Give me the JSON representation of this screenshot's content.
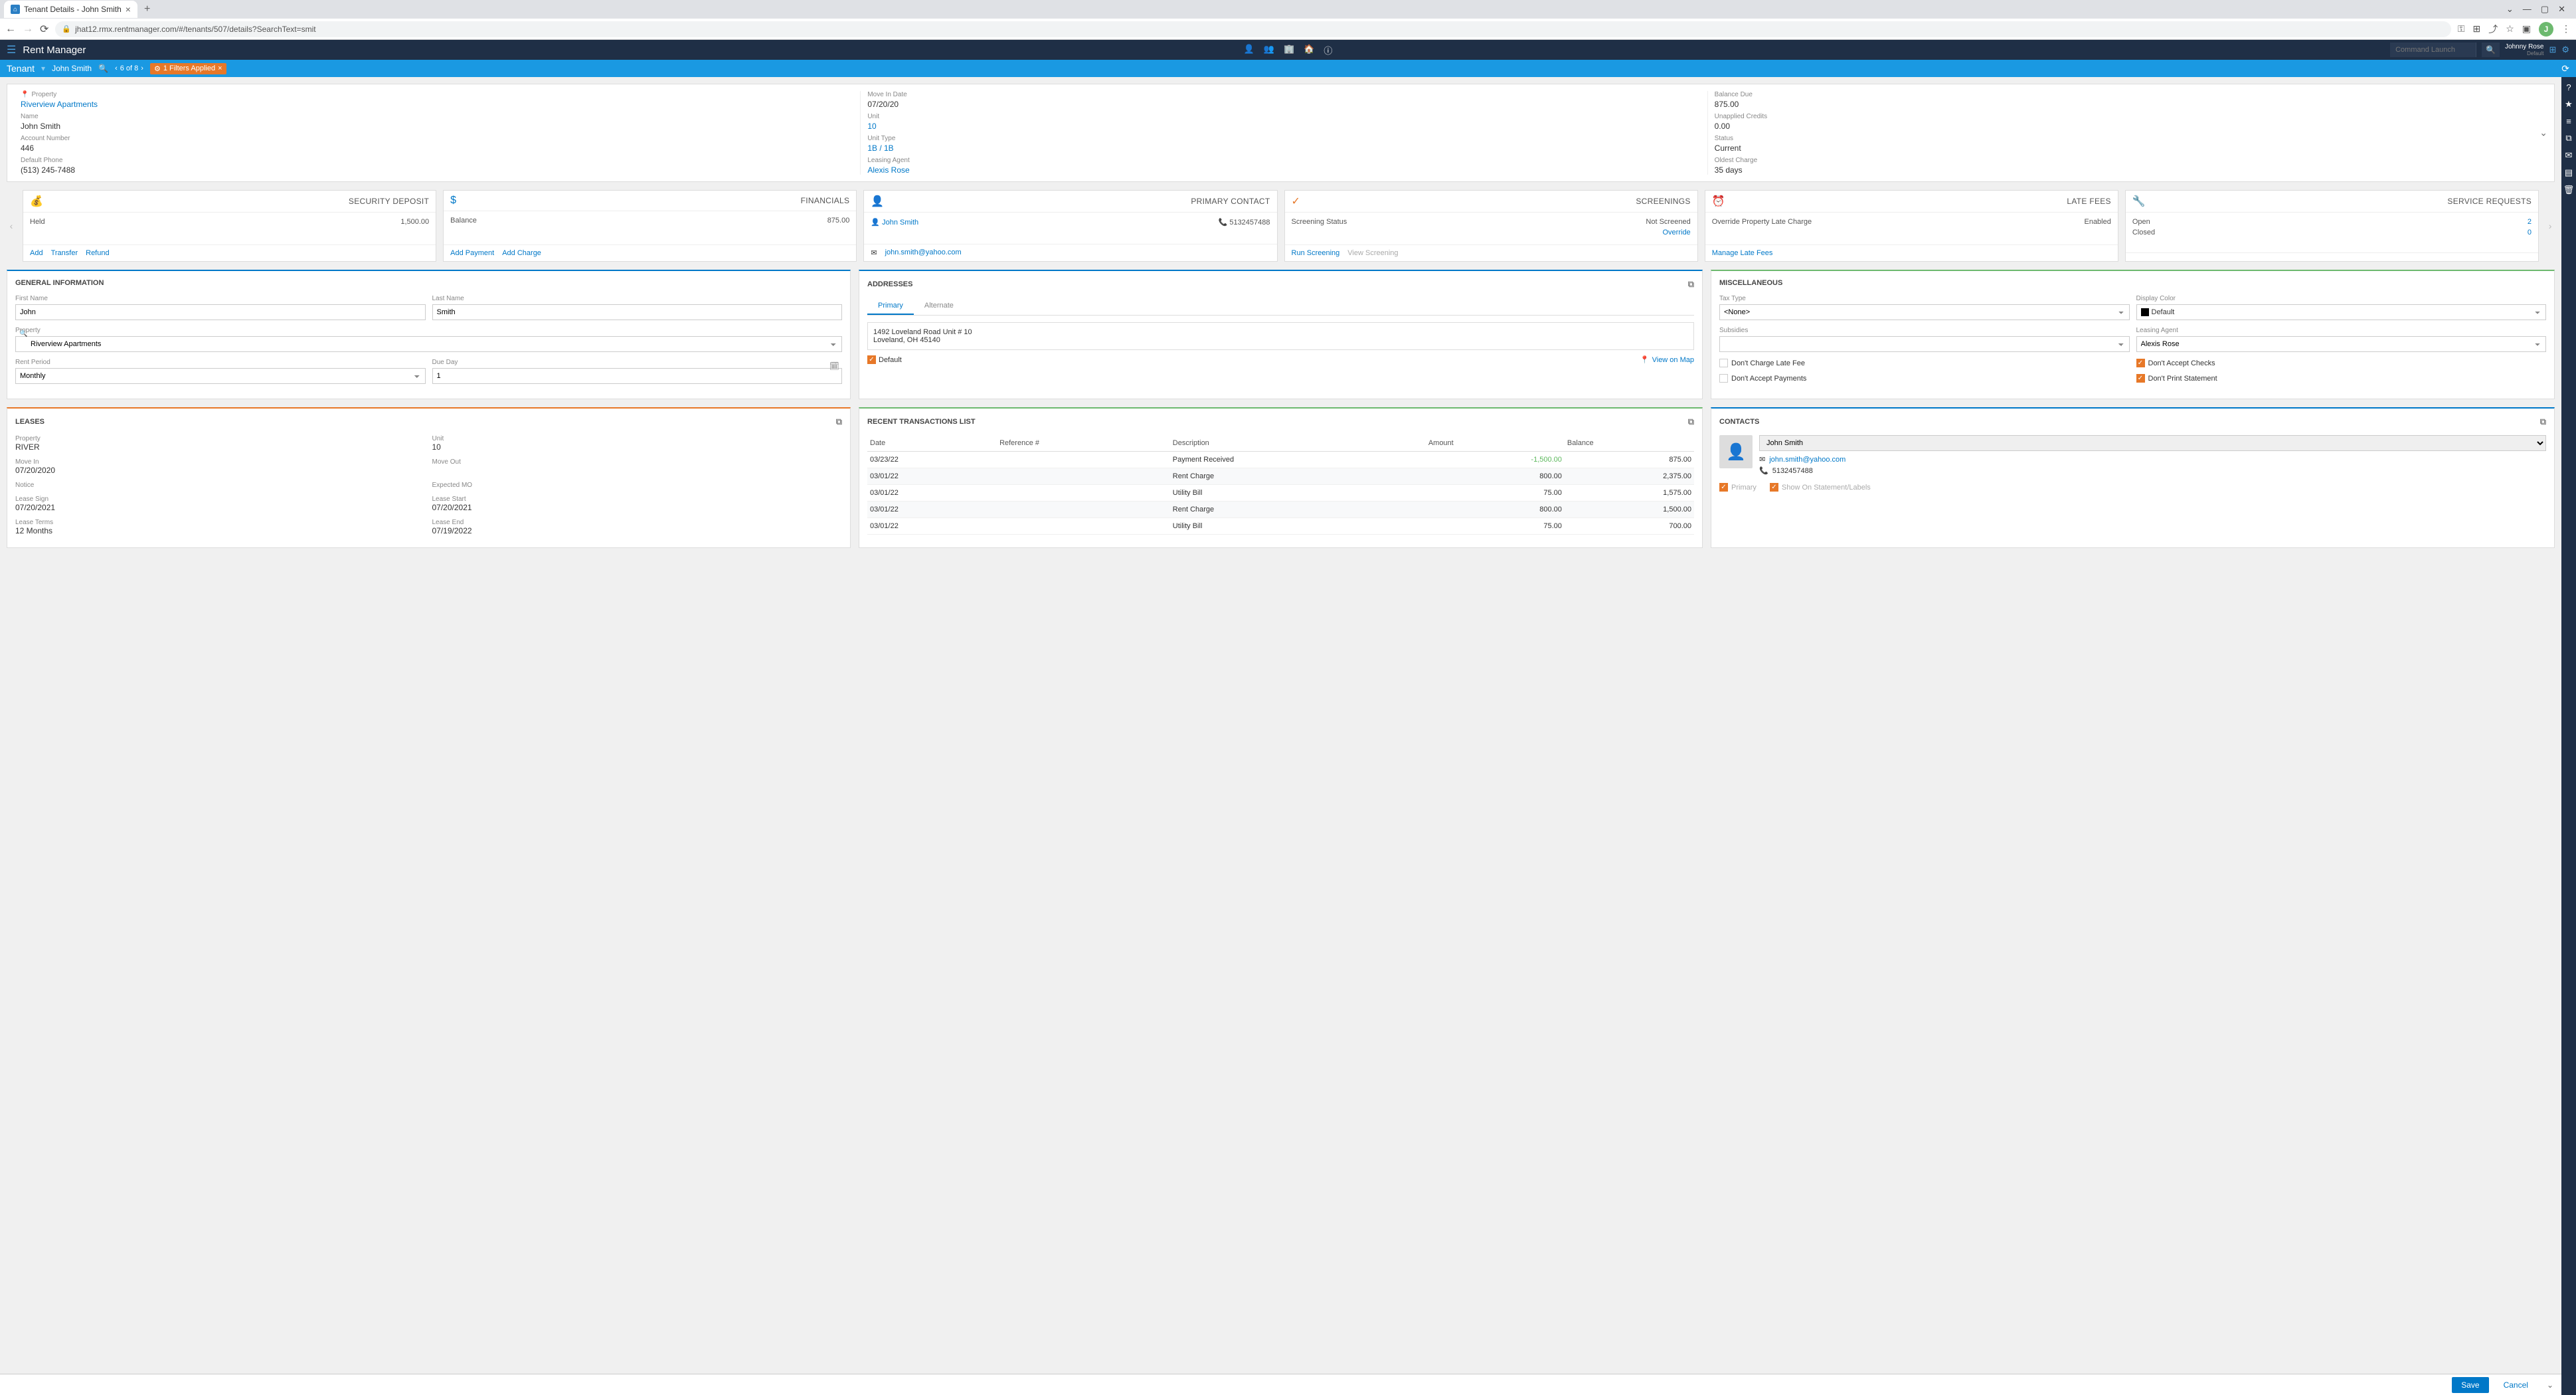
{
  "browser": {
    "tab_title": "Tenant Details - John Smith",
    "url": "jhat12.rmx.rentmanager.com/#/tenants/507/details?SearchText=smit",
    "profile_initial": "J"
  },
  "header": {
    "app_title": "Rent Manager",
    "command_placeholder": "Command Launch",
    "user_name": "Johnny Rose",
    "user_sub": "Default"
  },
  "secondary": {
    "page_type": "Tenant",
    "page_name": "John Smith",
    "pager": "6 of 8",
    "filter_text": "1 Filters Applied"
  },
  "summary": {
    "col1": {
      "property_label": "Property",
      "property_value": "Riverview Apartments",
      "name_label": "Name",
      "name_value": "John Smith",
      "acct_label": "Account Number",
      "acct_value": "446",
      "phone_label": "Default Phone",
      "phone_value": "(513) 245-7488"
    },
    "col2": {
      "movein_label": "Move In Date",
      "movein_value": "07/20/20",
      "unit_label": "Unit",
      "unit_value": "10",
      "unittype_label": "Unit Type",
      "unittype_value": "1B / 1B",
      "agent_label": "Leasing Agent",
      "agent_value": "Alexis Rose"
    },
    "col3": {
      "balance_label": "Balance Due",
      "balance_value": "875.00",
      "credits_label": "Unapplied Credits",
      "credits_value": "0.00",
      "status_label": "Status",
      "status_value": "Current",
      "oldest_label": "Oldest Charge",
      "oldest_value": "35 days"
    }
  },
  "tiles": {
    "security": {
      "title": "SECURITY DEPOSIT",
      "held_label": "Held",
      "held_value": "1,500.00",
      "add": "Add",
      "transfer": "Transfer",
      "refund": "Refund"
    },
    "financials": {
      "title": "FINANCIALS",
      "balance_label": "Balance",
      "balance_value": "875.00",
      "add_payment": "Add Payment",
      "add_charge": "Add Charge"
    },
    "primary_contact": {
      "title": "PRIMARY CONTACT",
      "name": "John Smith",
      "phone": "5132457488",
      "email": "john.smith@yahoo.com"
    },
    "screenings": {
      "title": "SCREENINGS",
      "status_label": "Screening Status",
      "status_value": "Not Screened",
      "override": "Override",
      "run": "Run Screening",
      "view": "View Screening"
    },
    "late_fees": {
      "title": "LATE FEES",
      "override_label": "Override Property Late Charge",
      "override_value": "Enabled",
      "manage": "Manage Late Fees"
    },
    "service": {
      "title": "SERVICE REQUESTS",
      "open_label": "Open",
      "open_value": "2",
      "closed_label": "Closed",
      "closed_value": "0"
    }
  },
  "general": {
    "title": "GENERAL INFORMATION",
    "first_name_label": "First Name",
    "first_name": "John",
    "last_name_label": "Last Name",
    "last_name": "Smith",
    "property_label": "Property",
    "property": "Riverview Apartments",
    "rent_period_label": "Rent Period",
    "rent_period": "Monthly",
    "due_day_label": "Due Day",
    "due_day": "1"
  },
  "addresses": {
    "title": "ADDRESSES",
    "tab_primary": "Primary",
    "tab_alternate": "Alternate",
    "line1": "1492 Loveland Road Unit # 10",
    "line2": "Loveland, OH 45140",
    "default_label": "Default",
    "view_map": "View on Map"
  },
  "misc": {
    "title": "MISCELLANEOUS",
    "tax_type_label": "Tax Type",
    "tax_type": "<None>",
    "display_color_label": "Display Color",
    "display_color": "Default",
    "subsidies_label": "Subsidies",
    "subsidies": "",
    "leasing_agent_label": "Leasing Agent",
    "leasing_agent": "Alexis Rose",
    "dont_charge_late": "Don't Charge Late Fee",
    "dont_accept_checks": "Don't Accept Checks",
    "dont_accept_payments": "Don't Accept Payments",
    "dont_print_statement": "Don't Print Statement"
  },
  "leases": {
    "title": "LEASES",
    "property_label": "Property",
    "property": "RIVER",
    "unit_label": "Unit",
    "unit": "10",
    "movein_label": "Move In",
    "movein": "07/20/2020",
    "moveout_label": "Move Out",
    "moveout": "",
    "notice_label": "Notice",
    "notice": "",
    "expected_mo_label": "Expected MO",
    "expected_mo": "",
    "lease_sign_label": "Lease Sign",
    "lease_sign": "07/20/2021",
    "lease_start_label": "Lease Start",
    "lease_start": "07/20/2021",
    "lease_terms_label": "Lease Terms",
    "lease_terms": "12 Months",
    "lease_end_label": "Lease End",
    "lease_end": "07/19/2022"
  },
  "transactions": {
    "title": "RECENT TRANSACTIONS LIST",
    "cols": {
      "date": "Date",
      "ref": "Reference #",
      "desc": "Description",
      "amount": "Amount",
      "balance": "Balance"
    },
    "rows": [
      {
        "date": "03/23/22",
        "ref": "",
        "desc": "Payment Received",
        "amount": "-1,500.00",
        "balance": "875.00",
        "neg": true
      },
      {
        "date": "03/01/22",
        "ref": "",
        "desc": "Rent Charge",
        "amount": "800.00",
        "balance": "2,375.00"
      },
      {
        "date": "03/01/22",
        "ref": "",
        "desc": "Utility Bill",
        "amount": "75.00",
        "balance": "1,575.00"
      },
      {
        "date": "03/01/22",
        "ref": "",
        "desc": "Rent Charge",
        "amount": "800.00",
        "balance": "1,500.00"
      },
      {
        "date": "03/01/22",
        "ref": "",
        "desc": "Utility Bill",
        "amount": "75.00",
        "balance": "700.00"
      }
    ]
  },
  "contacts": {
    "title": "CONTACTS",
    "name": "John Smith",
    "email": "john.smith@yahoo.com",
    "phone": "5132457488",
    "primary_label": "Primary",
    "show_label": "Show On Statement/Labels"
  },
  "footer": {
    "save": "Save",
    "cancel": "Cancel"
  }
}
